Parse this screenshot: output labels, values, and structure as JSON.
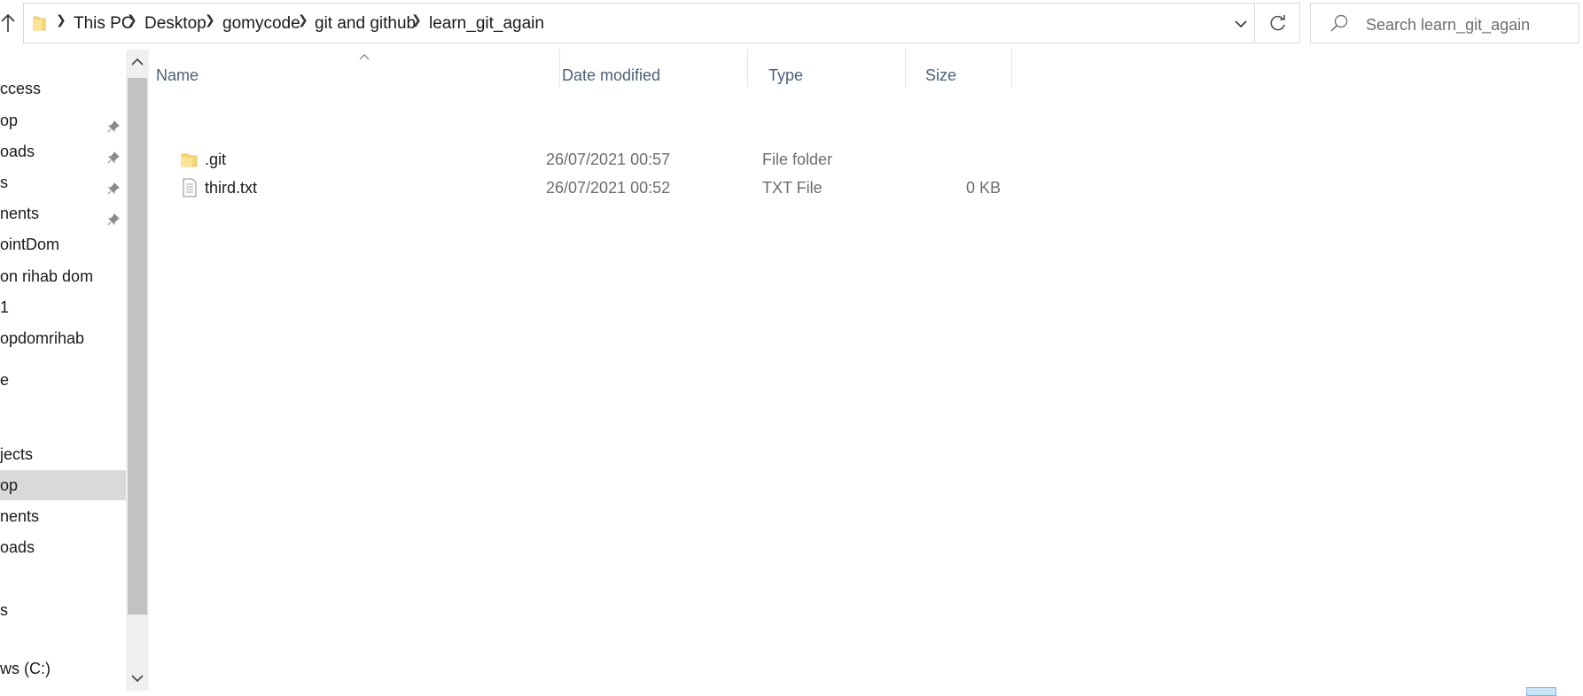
{
  "breadcrumbs": [
    "This PC",
    "Desktop",
    "gomycode",
    "git and github",
    "learn_git_again"
  ],
  "search": {
    "placeholder": "Search learn_git_again"
  },
  "nav": {
    "items": [
      {
        "label": "ccess",
        "pinned": false,
        "selected": false
      },
      {
        "label": "op",
        "pinned": true,
        "selected": false
      },
      {
        "label": "oads",
        "pinned": true,
        "selected": false
      },
      {
        "label": "s",
        "pinned": true,
        "selected": false
      },
      {
        "label": "nents",
        "pinned": true,
        "selected": false
      },
      {
        "label": "ointDom",
        "pinned": false,
        "selected": false
      },
      {
        "label": "on rihab dom",
        "pinned": false,
        "selected": false
      },
      {
        "label": "1",
        "pinned": false,
        "selected": false
      },
      {
        "label": "opdomrihab",
        "pinned": false,
        "selected": false
      },
      {
        "label": "e",
        "pinned": false,
        "selected": false
      },
      {
        "label": "jects",
        "pinned": false,
        "selected": false
      },
      {
        "label": "op",
        "pinned": false,
        "selected": true
      },
      {
        "label": "nents",
        "pinned": false,
        "selected": false
      },
      {
        "label": "oads",
        "pinned": false,
        "selected": false
      },
      {
        "label": "s",
        "pinned": false,
        "selected": false
      },
      {
        "label": "ws (C:)",
        "pinned": false,
        "selected": false
      }
    ]
  },
  "columns": {
    "name": "Name",
    "date": "Date modified",
    "type": "Type",
    "size": "Size"
  },
  "files": [
    {
      "name": ".git",
      "date": "26/07/2021 00:57",
      "type": "File folder",
      "size": "",
      "icon": "folder-icon"
    },
    {
      "name": "third.txt",
      "date": "26/07/2021 00:52",
      "type": "TXT File",
      "size": "0 KB",
      "icon": "text-file-icon"
    }
  ],
  "colors": {
    "folder": "#f8d775",
    "column_header_text": "#4c607a",
    "selected_nav": "#d9d9d9",
    "meta_text": "#6d6d6d"
  }
}
